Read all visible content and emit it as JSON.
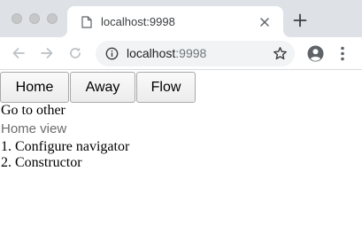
{
  "browser": {
    "tab": {
      "title": "localhost:9998",
      "icon": "page-icon",
      "close_icon": "close-icon"
    },
    "new_tab_icon": "plus-icon",
    "toolbar": {
      "back_icon": "back-arrow-icon",
      "forward_icon": "forward-arrow-icon",
      "reload_icon": "reload-icon",
      "address": {
        "host": "localhost",
        "port": ":9998",
        "info_icon": "info-icon",
        "bookmark_icon": "star-icon"
      },
      "profile_icon": "account-icon",
      "menu_icon": "more-vert-icon"
    },
    "colors": {
      "tabstrip_bg": "#dee1e6",
      "omnibox_bg": "#f1f3f4",
      "secondary_text": "#6b6b6b"
    }
  },
  "page": {
    "nav_buttons": [
      "Home",
      "Away",
      "Flow"
    ],
    "link_text": "Go to other",
    "view_title": "Home view",
    "steps": [
      "1. Configure navigator",
      "2. Constructor"
    ]
  }
}
